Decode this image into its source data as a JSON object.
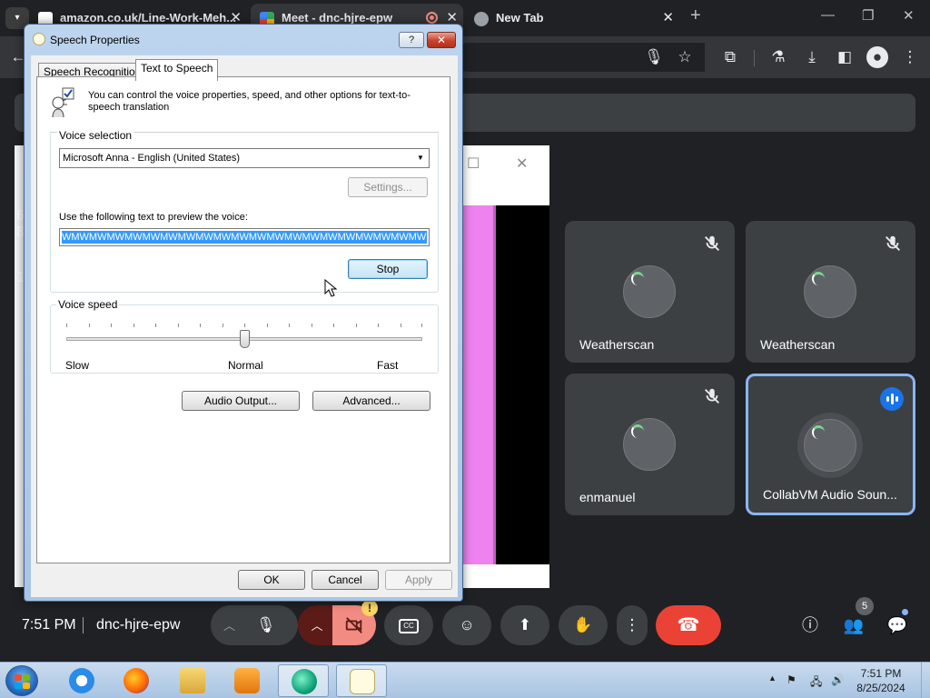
{
  "browser": {
    "tabs": [
      {
        "title": "amazon.co.uk/Line-Work-Meh...",
        "favicon": "amazon-icon"
      },
      {
        "title": "Meet - dnc-hjre-epw",
        "favicon": "meet-icon",
        "recording": true
      },
      {
        "title": "New Tab",
        "favicon": "chrome-icon"
      }
    ]
  },
  "meet": {
    "time": "7:51 PM",
    "code": "dnc-hjre-epw",
    "participants_count": "5",
    "tiles": [
      {
        "name": "Weatherscan"
      },
      {
        "name": "Weatherscan"
      },
      {
        "name": "enmanuel"
      },
      {
        "name": "CollabVM Audio Soun..."
      }
    ],
    "left_text": [
      "6",
      "8",
      "1"
    ],
    "warn_badge": "!"
  },
  "dialog": {
    "title": "Speech Properties",
    "help_label": "?",
    "tabs": [
      "Speech Recognition",
      "Text to Speech"
    ],
    "description": "You can control the voice properties, speed, and other options for text-to-speech translation",
    "voice_selection_label": "Voice selection",
    "voice": "Microsoft Anna - English (United States)",
    "settings_label": "Settings...",
    "preview_label": "Use the following text to preview the voice:",
    "preview_text": "WMWMWMWMWMWMWMWMWMWMWMWMWMWMWMWMWMWMWMWMWMWMWMWMWMWM",
    "stop_label": "Stop",
    "voice_speed_label": "Voice speed",
    "slow_label": "Slow",
    "normal_label": "Normal",
    "fast_label": "Fast",
    "speed_level": 0.5,
    "audio_output_label": "Audio Output...",
    "advanced_label": "Advanced...",
    "ok_label": "OK",
    "cancel_label": "Cancel",
    "apply_label": "Apply"
  },
  "taskbar": {
    "time": "7:51 PM",
    "date": "8/25/2024"
  },
  "colors": {
    "meet_bg": "#202124",
    "tile_bg": "#3c4043",
    "end_call": "#ea4335",
    "active_tile_border": "#8ab4f8",
    "selection": "#3399ff"
  }
}
